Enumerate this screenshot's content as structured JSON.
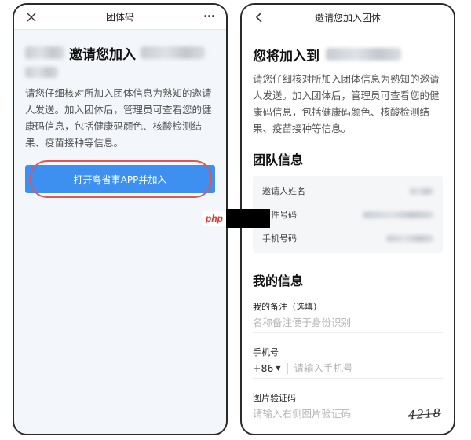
{
  "left": {
    "header": {
      "title": "团体码",
      "close_icon": "close-icon",
      "more_icon": "more-dots-icon",
      "more_glyph": "•••"
    },
    "invite_text": "邀请您加入",
    "description": "请您仔细核对所加入团体信息为熟知的邀请人发送。加入团体后，管理员可查看您的健康码信息，包括健康码颜色、核酸检测结果、疫苗接种等信息。",
    "open_button_label": "打开粤省事APP并加入",
    "highlight_color": "#e05555",
    "button_color": "#3d8ff0"
  },
  "right": {
    "header": {
      "title": "邀请您加入团体",
      "back_icon": "chevron-left-icon"
    },
    "join_text": "您将加入到",
    "description": "请您仔细核对所加入团体信息为熟知的邀请人发送。加入团体后，管理员可查看您的健康码信息，包括健康码颜色、核酸检测结果、疫苗接种等信息。",
    "team_section": {
      "title": "团队信息",
      "rows": [
        {
          "label": "邀请人姓名"
        },
        {
          "label": "证件号码"
        },
        {
          "label": "手机号码"
        }
      ]
    },
    "my_section": {
      "title": "我的信息",
      "remark": {
        "label": "我的备注（选填）",
        "placeholder": "名称备注便于身份识别"
      },
      "phone": {
        "label": "手机号",
        "country_code": "+86",
        "placeholder": "请输入手机号"
      },
      "captcha": {
        "label": "图片验证码",
        "placeholder": "请输入右侧图片验证码",
        "image_text": "4218"
      }
    }
  },
  "watermark": {
    "logo_text": "php"
  }
}
